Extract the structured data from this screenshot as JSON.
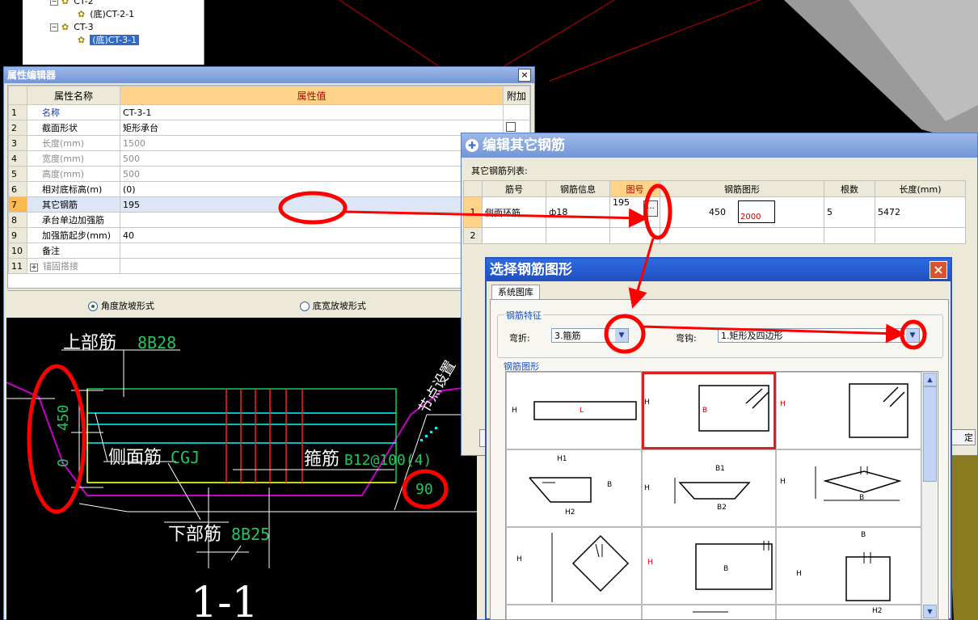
{
  "tree": {
    "items": [
      {
        "prefix": "⊟",
        "label": "CT-2",
        "level": 0
      },
      {
        "prefix": "",
        "label": "(底)CT-2-1",
        "level": 1
      },
      {
        "prefix": "⊟",
        "label": "CT-3",
        "level": 0
      },
      {
        "prefix": "",
        "label": "(底)CT-3-1",
        "level": 1,
        "selected": true
      }
    ]
  },
  "prop_editor": {
    "title": "属性编辑器",
    "close": "×",
    "headers": {
      "name": "属性名称",
      "value": "属性值",
      "extra": "附加"
    },
    "rows": [
      {
        "num": "1",
        "name": "名称",
        "value": "CT-3-1",
        "style": "blue"
      },
      {
        "num": "2",
        "name": "截面形状",
        "value": "矩形承台",
        "style": ""
      },
      {
        "num": "3",
        "name": "长度(mm)",
        "value": "1500",
        "style": "grey"
      },
      {
        "num": "4",
        "name": "宽度(mm)",
        "value": "500",
        "style": "grey"
      },
      {
        "num": "5",
        "name": "高度(mm)",
        "value": "500",
        "style": "grey"
      },
      {
        "num": "6",
        "name": "相对底标高(m)",
        "value": "(0)",
        "style": ""
      },
      {
        "num": "7",
        "name": "其它钢筋",
        "value": "195",
        "style": "",
        "selected": true
      },
      {
        "num": "8",
        "name": "承台单边加强筋",
        "value": "",
        "style": ""
      },
      {
        "num": "9",
        "name": "加强筋起步(mm)",
        "value": "40",
        "style": ""
      },
      {
        "num": "10",
        "name": "备注",
        "value": "",
        "style": ""
      },
      {
        "num": "11",
        "name": "锚固搭接",
        "value": "",
        "style": "grey",
        "expand": "+"
      }
    ],
    "radio_angle": "角度放坡形式",
    "radio_width": "底宽放坡形式"
  },
  "drawing": {
    "top_bar_label": "上部筋",
    "top_bar_value": "8B28",
    "side_bar_label": "侧面筋",
    "side_bar_value": "CGJ",
    "stirrup_label": "箍筋",
    "stirrup_value": "B12@100(4)",
    "bottom_bar_label": "下部筋",
    "bottom_bar_value": "8B25",
    "dim_450": "450",
    "dim_0": "0",
    "angle": "90",
    "node_text": "节点设置",
    "section": "1-1"
  },
  "other_rebar": {
    "title": "编辑其它钢筋",
    "list_label": "其它钢筋列表:",
    "headers": [
      "筋号",
      "钢筋信息",
      "图号",
      "钢筋图形",
      "根数",
      "长度(mm)"
    ],
    "rows": [
      {
        "num": "1",
        "name": "侧面环筋",
        "info": "ф18",
        "fig": "195",
        "fig_btn": "...",
        "dim_a": "450",
        "dim_b": "2000",
        "count": "5",
        "length": "5472"
      },
      {
        "num": "2",
        "name": "",
        "info": "",
        "fig": "",
        "fig_btn": "",
        "dim_a": "",
        "dim_b": "",
        "count": "",
        "length": ""
      }
    ],
    "ok_partial": "定"
  },
  "shape_select": {
    "title": "选择钢筋图形",
    "close": "×",
    "tab": "系统图库",
    "feature_label": "钢筋特征",
    "bend_label": "弯折:",
    "bend_value": "3.箍筋",
    "hook_label": "弯钩:",
    "hook_value": "1.矩形及四边形",
    "shape_label": "钢筋图形",
    "shapes": [
      {
        "labels": [
          "H",
          "L"
        ]
      },
      {
        "labels": [
          "H",
          "B"
        ]
      },
      {
        "labels": [
          "H"
        ]
      },
      {
        "labels": [
          "H1",
          "B",
          "H2"
        ]
      },
      {
        "labels": [
          "B1",
          "H",
          "B2"
        ]
      },
      {
        "labels": [
          "H",
          "B"
        ]
      },
      {
        "labels": [
          "H"
        ]
      },
      {
        "labels": [
          "H",
          "B"
        ]
      },
      {
        "labels": [
          "B",
          "H"
        ]
      }
    ],
    "bottom_partial": [
      "H2"
    ]
  },
  "colors": {
    "annotation_red": "#ff0000",
    "bar_green": "#22c55e",
    "bar_cyan": "#00ffff",
    "bar_yellow": "#ffff00",
    "titlebar_blue": "#7195d6",
    "header_orange": "#ffd28a"
  }
}
